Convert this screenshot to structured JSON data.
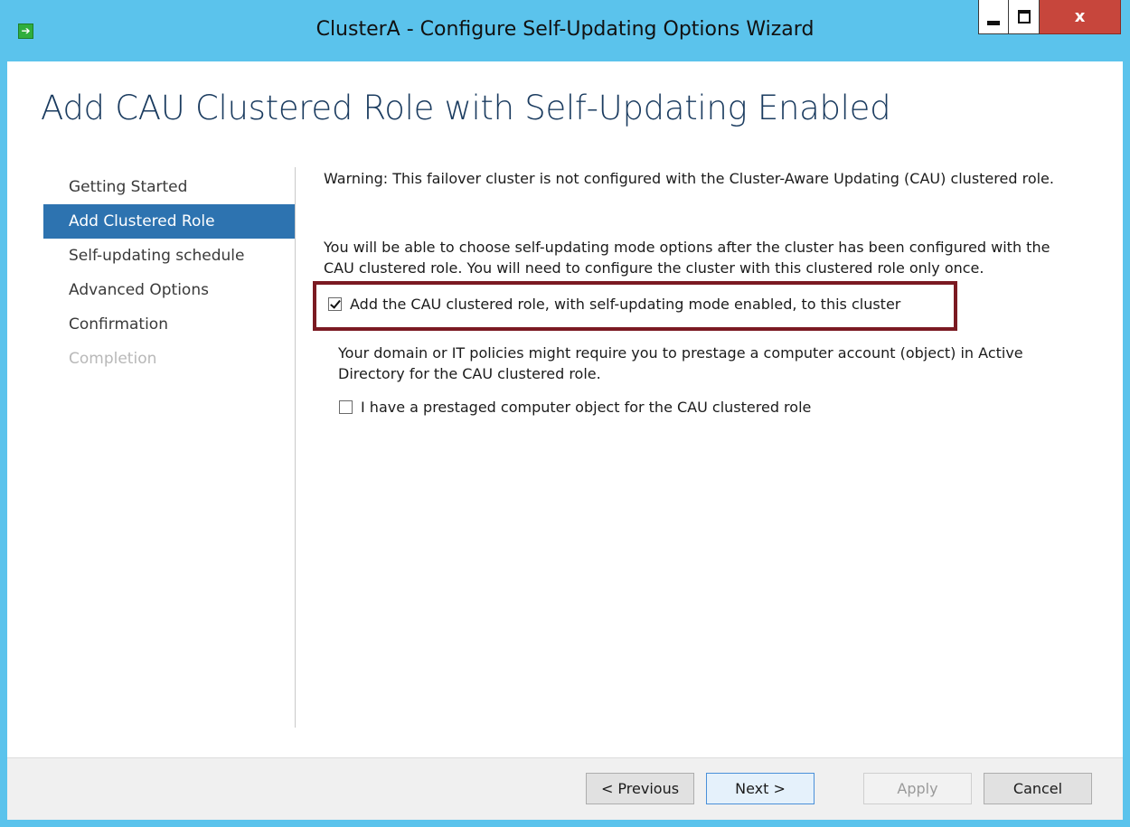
{
  "window": {
    "title": "ClusterA - Configure Self-Updating Options Wizard",
    "app_icon_glyph": "➔",
    "close_glyph": "x"
  },
  "page": {
    "heading": "Add CAU Clustered Role with Self-Updating Enabled"
  },
  "nav": {
    "items": [
      {
        "label": "Getting Started",
        "state": "normal"
      },
      {
        "label": "Add Clustered Role",
        "state": "active"
      },
      {
        "label": "Self-updating schedule",
        "state": "normal"
      },
      {
        "label": "Advanced Options",
        "state": "normal"
      },
      {
        "label": "Confirmation",
        "state": "normal"
      },
      {
        "label": "Completion",
        "state": "disabled"
      }
    ]
  },
  "content": {
    "warning": "Warning: This failover cluster is not configured with the Cluster-Aware Updating (CAU) clustered role.",
    "info": "You will be able to choose self-updating mode options after the cluster has been configured with the CAU clustered role. You will need to configure the cluster with this clustered role only once.",
    "add_role_checkbox": {
      "label": "Add the CAU clustered role, with self-updating mode enabled, to this cluster",
      "checked": true
    },
    "policy_note": "Your domain or IT policies might require you to prestage a computer account (object) in Active Directory for the CAU clustered role.",
    "prestaged_checkbox": {
      "label": "I have a prestaged computer object for the CAU clustered role",
      "checked": false
    }
  },
  "footer": {
    "previous_label": "< Previous",
    "next_label": "Next >",
    "apply_label": "Apply",
    "cancel_label": "Cancel"
  },
  "colors": {
    "titlebar": "#5bc3ec",
    "nav_active": "#2d73b0",
    "highlight_border": "#7b1a22",
    "close_button": "#c7463c"
  }
}
